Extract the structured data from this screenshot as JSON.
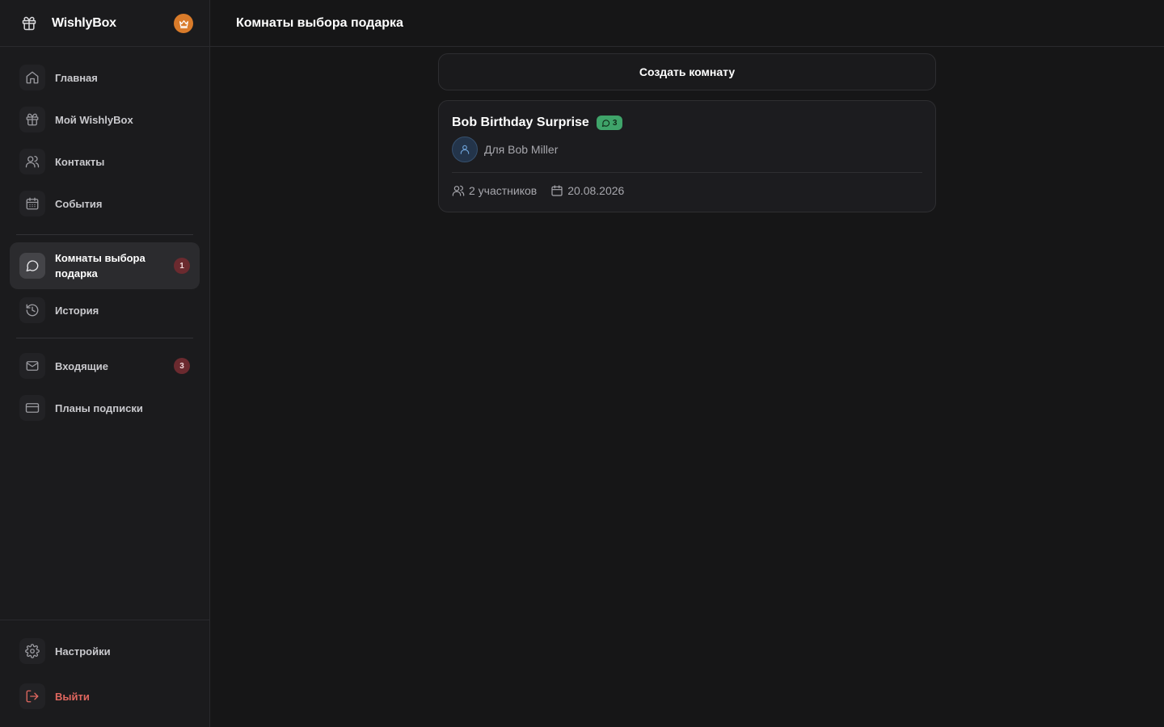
{
  "app": {
    "name": "WishlyBox"
  },
  "header": {
    "title": "Комнаты выбора подарка"
  },
  "sidebar": {
    "items": [
      {
        "label": "Главная",
        "icon": "home-icon"
      },
      {
        "label": "Мой WishlyBox",
        "icon": "gift-icon"
      },
      {
        "label": "Контакты",
        "icon": "users-icon"
      },
      {
        "label": "События",
        "icon": "calendar-icon"
      },
      {
        "label": "Комнаты выбора подарка",
        "icon": "chat-icon",
        "active": true,
        "badge": "1"
      },
      {
        "label": "История",
        "icon": "history-icon"
      },
      {
        "label": "Входящие",
        "icon": "mail-icon",
        "badge": "3"
      },
      {
        "label": "Планы подписки",
        "icon": "credit-card-icon"
      }
    ],
    "settings_label": "Настройки",
    "logout_label": "Выйти"
  },
  "main": {
    "create_button": "Создать комнату",
    "rooms": [
      {
        "title": "Bob Birthday Surprise",
        "messages": "3",
        "for_text": "Для Bob Miller",
        "participants": "2 участников",
        "date": "20.08.2026"
      }
    ]
  },
  "colors": {
    "background": "#161617",
    "sidebar": "#1b1b1d",
    "accent_green": "#3fa46a",
    "badge_red": "#6b2a2f",
    "logout_red": "#e0675f",
    "crown_orange": "#d97b2a"
  }
}
